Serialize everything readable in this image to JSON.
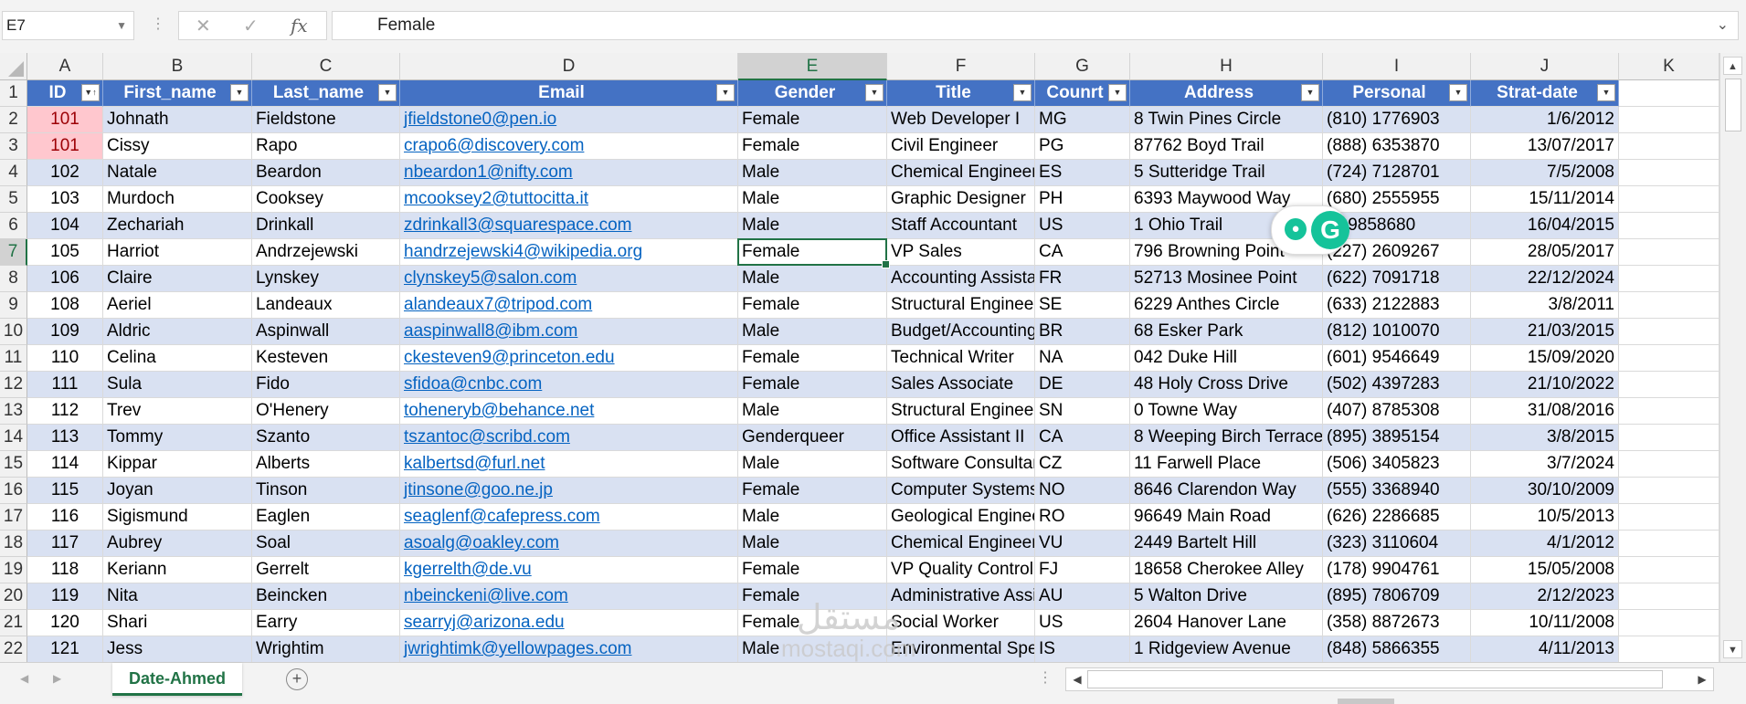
{
  "formula_bar": {
    "name_box": "E7",
    "formula_value": "Female",
    "fx_label": "fx",
    "cancel_glyph": "✕",
    "enter_glyph": "✓",
    "dropdown_glyph": "⌄"
  },
  "columns": [
    "A",
    "B",
    "C",
    "D",
    "E",
    "F",
    "G",
    "H",
    "I",
    "J",
    "K"
  ],
  "selected_column": "E",
  "selected_row": 7,
  "table": {
    "headers": [
      "ID",
      "First_name",
      "Last_name",
      "Email",
      "Gender",
      "Title",
      "Counrt",
      "Address",
      "Personal",
      "Strat-date"
    ],
    "sorted_column": "ID",
    "header_color": "#4472c4",
    "band_color": "#d9e1f2",
    "duplicate_highlight_color": "#ffc7ce",
    "rows": [
      {
        "row": 2,
        "id": "101",
        "dup": true,
        "first": "Johnath",
        "last": "Fieldstone",
        "email": "jfieldstone0@pen.io",
        "gender": "Female",
        "title": "Web Developer I",
        "country": "MG",
        "address": "8 Twin Pines Circle",
        "phone": "(810) 1776903",
        "date": "1/6/2012"
      },
      {
        "row": 3,
        "id": "101",
        "dup": true,
        "first": "Cissy",
        "last": "Rapo",
        "email": "crapo6@discovery.com",
        "gender": "Female",
        "title": "Civil Engineer",
        "country": "PG",
        "address": "87762 Boyd Trail",
        "phone": "(888) 6353870",
        "date": "13/07/2017"
      },
      {
        "row": 4,
        "id": "102",
        "dup": false,
        "first": "Natale",
        "last": "Beardon",
        "email": "nbeardon1@nifty.com",
        "gender": "Male",
        "title": "Chemical Engineer",
        "country": "ES",
        "address": "5 Sutteridge Trail",
        "phone": "(724) 7128701",
        "date": "7/5/2008"
      },
      {
        "row": 5,
        "id": "103",
        "dup": false,
        "first": "Murdoch",
        "last": "Cooksey",
        "email": "mcooksey2@tuttocitta.it",
        "gender": "Male",
        "title": "Graphic Designer",
        "country": "PH",
        "address": "6393 Maywood Way",
        "phone": "(680) 2555955",
        "date": "15/11/2014"
      },
      {
        "row": 6,
        "id": "104",
        "dup": false,
        "first": "Zechariah",
        "last": "Drinkall",
        "email": "zdrinkall3@squarespace.com",
        "gender": "Male",
        "title": "Staff Accountant",
        "country": "US",
        "address": "1 Ohio Trail",
        "phone": "(   ) 9858680",
        "date": "16/04/2015"
      },
      {
        "row": 7,
        "id": "105",
        "dup": false,
        "first": "Harriot",
        "last": "Andrzejewski",
        "email": "handrzejewski4@wikipedia.org",
        "gender": "Female",
        "title": "VP Sales",
        "country": "CA",
        "address": "796 Browning Point",
        "phone": "(227) 2609267",
        "date": "28/05/2017"
      },
      {
        "row": 8,
        "id": "106",
        "dup": false,
        "first": "Claire",
        "last": "Lynskey",
        "email": "clynskey5@salon.com",
        "gender": "Male",
        "title": "Accounting Assistant",
        "country": "FR",
        "address": "52713 Mosinee Point",
        "phone": "(622) 7091718",
        "date": "22/12/2024"
      },
      {
        "row": 9,
        "id": "108",
        "dup": false,
        "first": "Aeriel",
        "last": "Landeaux",
        "email": "alandeaux7@tripod.com",
        "gender": "Female",
        "title": "Structural Engineer",
        "country": "SE",
        "address": "6229 Anthes Circle",
        "phone": "(633) 2122883",
        "date": "3/8/2011"
      },
      {
        "row": 10,
        "id": "109",
        "dup": false,
        "first": "Aldric",
        "last": "Aspinwall",
        "email": "aaspinwall8@ibm.com",
        "gender": "Male",
        "title": "Budget/Accounting",
        "country": "BR",
        "address": "68 Esker Park",
        "phone": "(812) 1010070",
        "date": "21/03/2015"
      },
      {
        "row": 11,
        "id": "110",
        "dup": false,
        "first": "Celina",
        "last": "Kesteven",
        "email": "ckesteven9@princeton.edu",
        "gender": "Female",
        "title": "Technical Writer",
        "country": "NA",
        "address": "042 Duke Hill",
        "phone": "(601) 9546649",
        "date": "15/09/2020"
      },
      {
        "row": 12,
        "id": "111",
        "dup": false,
        "first": "Sula",
        "last": "Fido",
        "email": "sfidoa@cnbc.com",
        "gender": "Female",
        "title": "Sales Associate",
        "country": "DE",
        "address": "48 Holy Cross Drive",
        "phone": "(502) 4397283",
        "date": "21/10/2022"
      },
      {
        "row": 13,
        "id": "112",
        "dup": false,
        "first": "Trev",
        "last": "O'Henery",
        "email": "toheneryb@behance.net",
        "gender": "Male",
        "title": "Structural Engineer",
        "country": "SN",
        "address": "0 Towne Way",
        "phone": "(407) 8785308",
        "date": "31/08/2016"
      },
      {
        "row": 14,
        "id": "113",
        "dup": false,
        "first": "Tommy",
        "last": "Szanto",
        "email": "tszantoc@scribd.com",
        "gender": "Genderqueer",
        "title": "Office Assistant II",
        "country": "CA",
        "address": "8 Weeping Birch Terrace",
        "phone": "(895) 3895154",
        "date": "3/8/2015"
      },
      {
        "row": 15,
        "id": "114",
        "dup": false,
        "first": "Kippar",
        "last": "Alberts",
        "email": "kalbertsd@furl.net",
        "gender": "Male",
        "title": "Software Consultant",
        "country": "CZ",
        "address": "11 Farwell Place",
        "phone": "(506) 3405823",
        "date": "3/7/2024"
      },
      {
        "row": 16,
        "id": "115",
        "dup": false,
        "first": "Joyan",
        "last": "Tinson",
        "email": "jtinsone@goo.ne.jp",
        "gender": "Female",
        "title": "Computer Systems",
        "country": "NO",
        "address": "8646 Clarendon Way",
        "phone": "(555) 3368940",
        "date": "30/10/2009"
      },
      {
        "row": 17,
        "id": "116",
        "dup": false,
        "first": "Sigismund",
        "last": "Eaglen",
        "email": "seaglenf@cafepress.com",
        "gender": "Male",
        "title": "Geological Engineer",
        "country": "RO",
        "address": "96649 Main Road",
        "phone": "(626) 2286685",
        "date": "10/5/2013"
      },
      {
        "row": 18,
        "id": "117",
        "dup": false,
        "first": "Aubrey",
        "last": "Soal",
        "email": "asoalg@oakley.com",
        "gender": "Male",
        "title": "Chemical Engineer",
        "country": "VU",
        "address": "2449 Bartelt Hill",
        "phone": "(323) 3110604",
        "date": "4/1/2012"
      },
      {
        "row": 19,
        "id": "118",
        "dup": false,
        "first": "Keriann",
        "last": "Gerrelt",
        "email": "kgerrelth@de.vu",
        "gender": "Female",
        "title": "VP Quality Control",
        "country": "FJ",
        "address": "18658 Cherokee Alley",
        "phone": "(178) 9904761",
        "date": "15/05/2008"
      },
      {
        "row": 20,
        "id": "119",
        "dup": false,
        "first": "Nita",
        "last": "Beincken",
        "email": "nbeinckeni@live.com",
        "gender": "Female",
        "title": "Administrative Assistant",
        "country": "AU",
        "address": "5 Walton Drive",
        "phone": "(895) 7806709",
        "date": "2/12/2023"
      },
      {
        "row": 21,
        "id": "120",
        "dup": false,
        "first": "Shari",
        "last": "Earry",
        "email": "searryj@arizona.edu",
        "gender": "Female",
        "title": "Social Worker",
        "country": "US",
        "address": "2604 Hanover Lane",
        "phone": "(358) 8872673",
        "date": "10/11/2008"
      },
      {
        "row": 22,
        "id": "121",
        "dup": false,
        "first": "Jess",
        "last": "Wrightim",
        "email": "jwrightimk@yellowpages.com",
        "gender": "Male",
        "title": "Environmental Specialist",
        "country": "IS",
        "address": "1 Ridgeview Avenue",
        "phone": "(848) 5866355",
        "date": "4/11/2013"
      }
    ]
  },
  "header_row_number": "1",
  "sheet_tabs": [
    {
      "label": "Date-Ahmed",
      "active": true
    }
  ],
  "add_sheet_glyph": "+",
  "watermark": {
    "logo": "مستقل",
    "text": "mostaqi.com"
  },
  "grammarly": {
    "letter": "G",
    "bulb": "💡"
  }
}
